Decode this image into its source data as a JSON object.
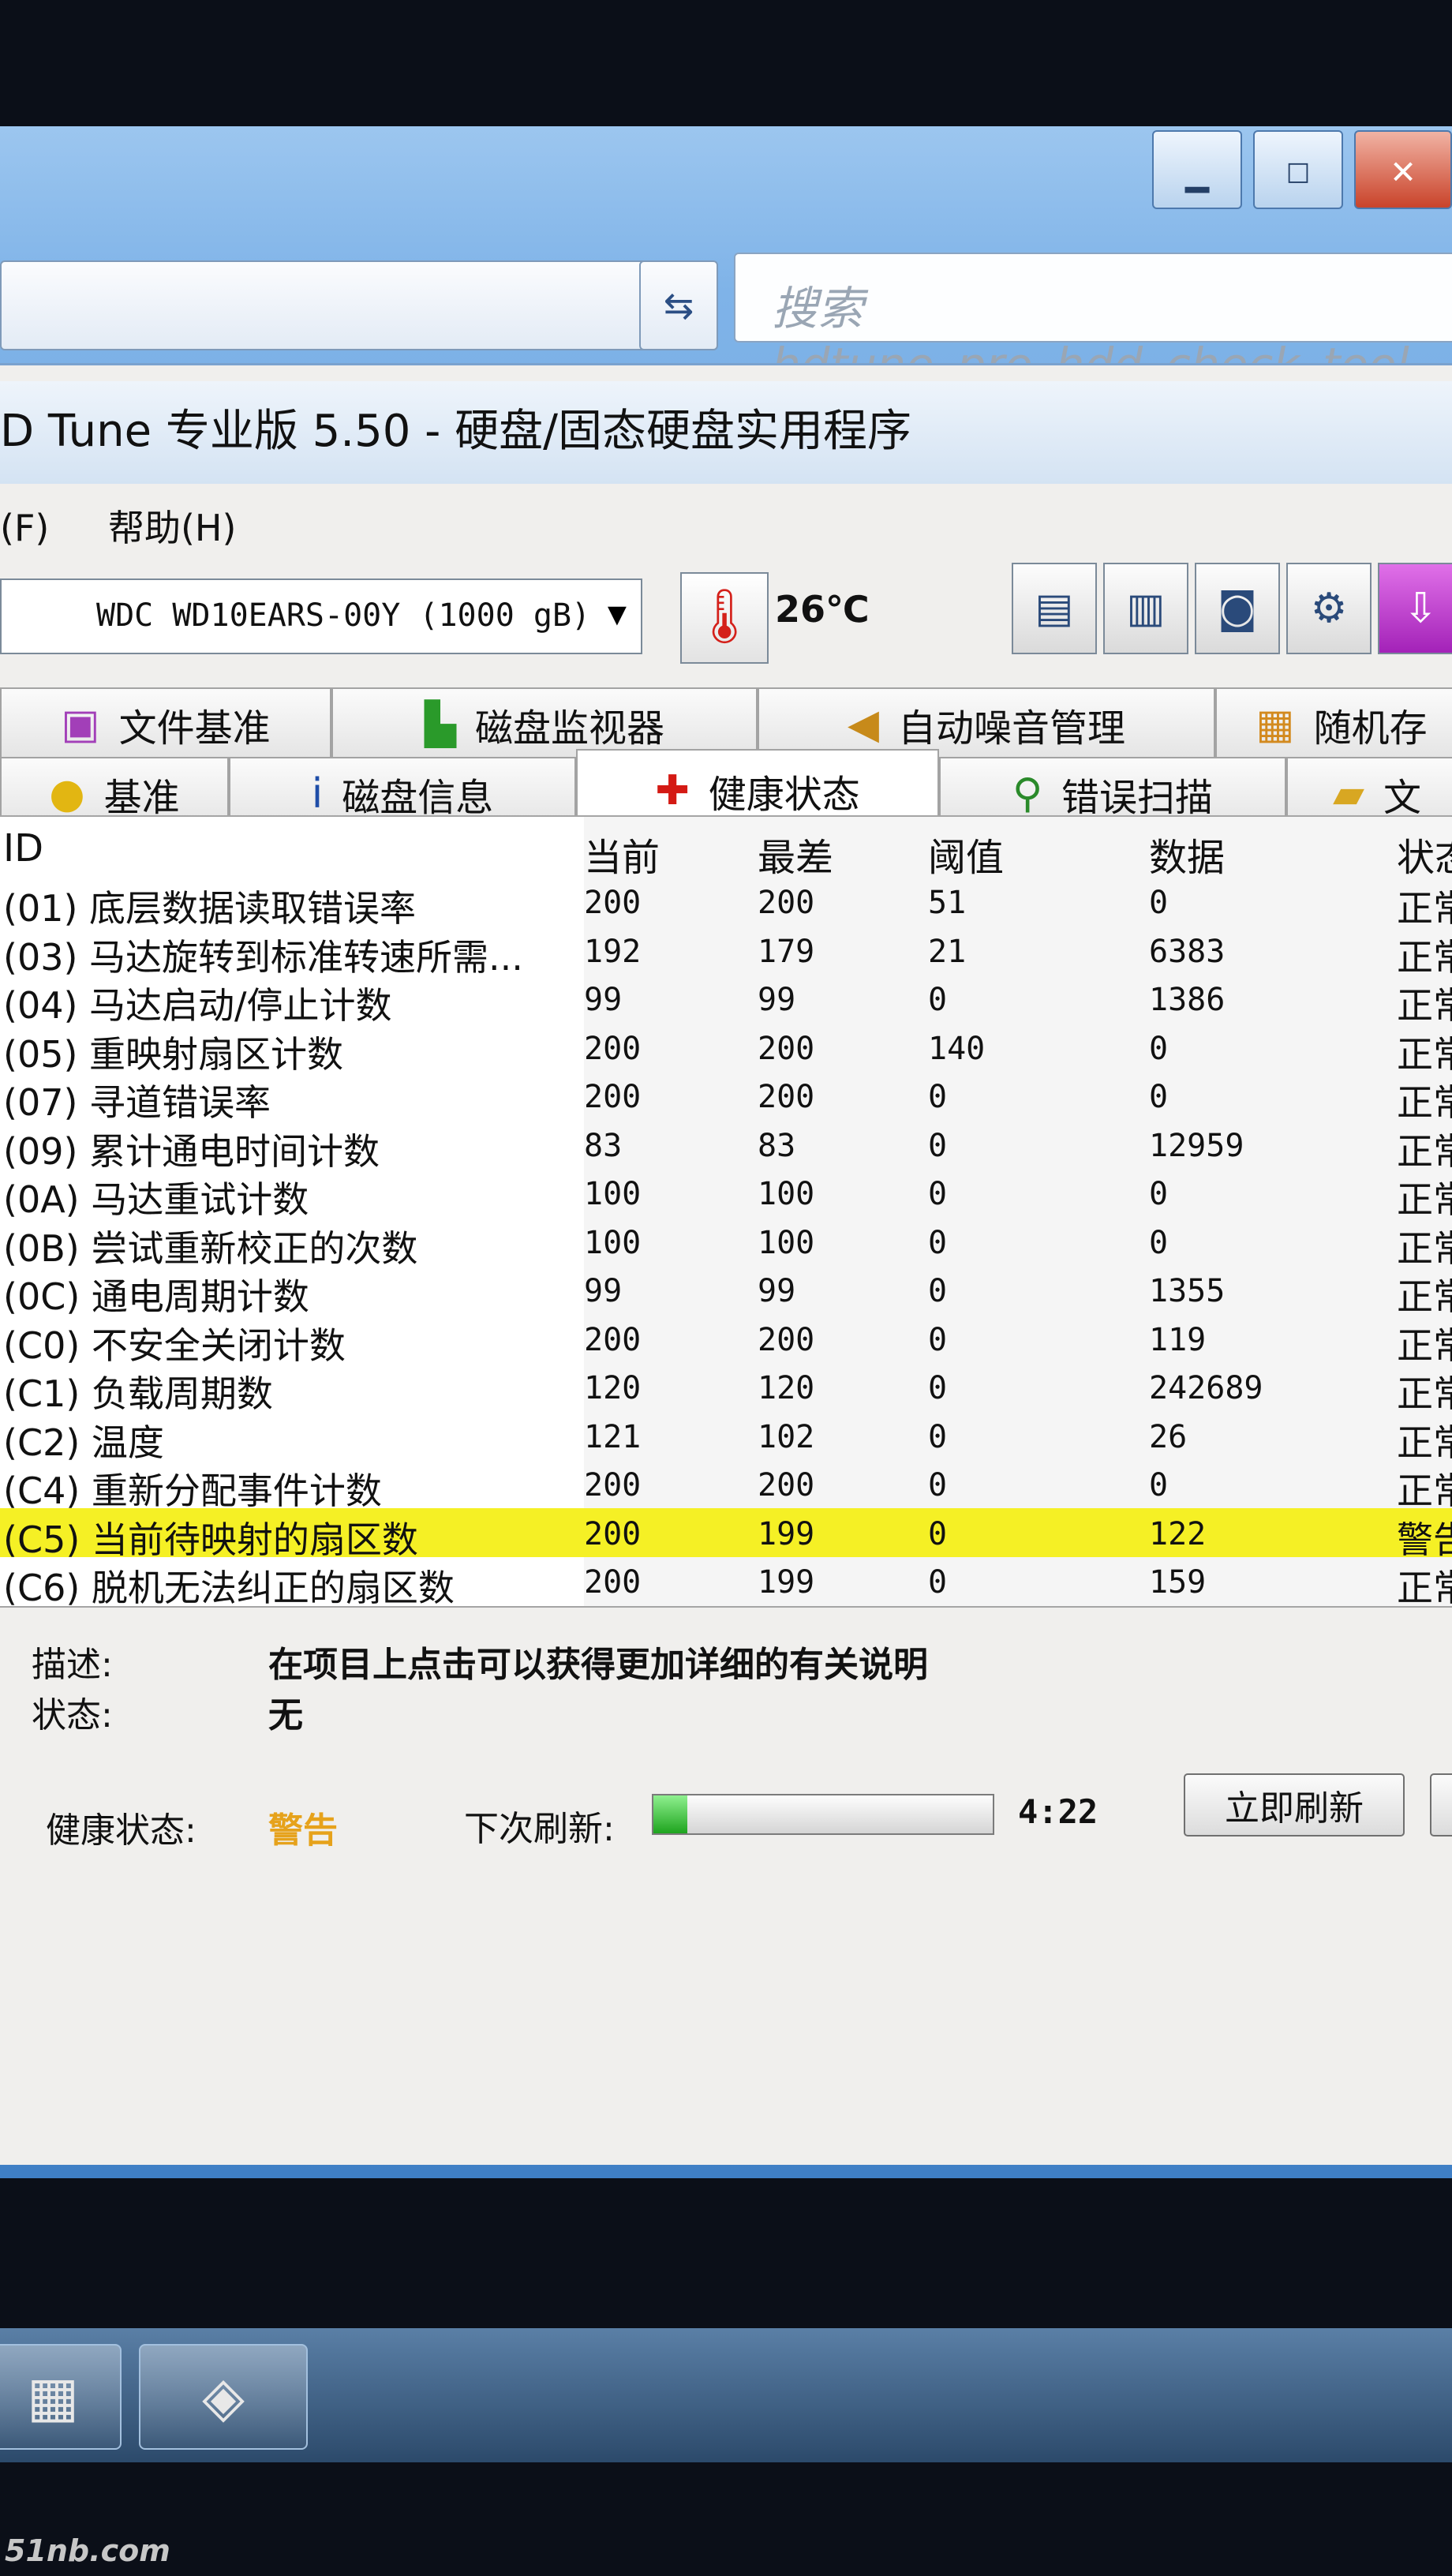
{
  "explorer": {
    "search_placeholder": "搜索 hdtune_pro_hdd_check_tool_...",
    "caption_buttons": [
      "▁",
      "☐",
      "✕"
    ]
  },
  "window": {
    "title": "D Tune 专业版 5.50 - 硬盘/固态硬盘实用程序"
  },
  "menu": [
    "(F)",
    "帮助(H)"
  ],
  "toolbar": {
    "drive": "WDC WD10EARS-00Y (1000 gB)",
    "temperature": "26℃",
    "icons": [
      "copy-text-icon",
      "copy-screen-icon",
      "camera-icon",
      "options-icon",
      "exit-icon"
    ]
  },
  "tabs_top": [
    {
      "label": "文件基准",
      "icon": "file-benchmark-icon"
    },
    {
      "label": "磁盘监视器",
      "icon": "disk-monitor-icon"
    },
    {
      "label": "自动噪音管理",
      "icon": "speaker-icon"
    },
    {
      "label": "随机存",
      "icon": "random-access-icon"
    }
  ],
  "tabs_bottom": [
    {
      "label": "基准",
      "icon": "benchmark-icon"
    },
    {
      "label": "磁盘信息",
      "icon": "info-icon"
    },
    {
      "label": "健康状态",
      "icon": "health-cross-icon"
    },
    {
      "label": "错误扫描",
      "icon": "magnifier-icon"
    },
    {
      "label": "文",
      "icon": "folder-icon"
    }
  ],
  "table": {
    "headers": [
      "ID",
      "当前",
      "最差",
      "阈值",
      "数据",
      "状态"
    ],
    "rows": [
      {
        "name": "(01) 底层数据读取错误率",
        "cur": "200",
        "worst": "200",
        "thr": "51",
        "raw": "0",
        "status": "正常"
      },
      {
        "name": "(03) 马达旋转到标准转速所需...",
        "cur": "192",
        "worst": "179",
        "thr": "21",
        "raw": "6383",
        "status": "正常"
      },
      {
        "name": "(04) 马达启动/停止计数",
        "cur": "99",
        "worst": "99",
        "thr": "0",
        "raw": "1386",
        "status": "正常"
      },
      {
        "name": "(05) 重映射扇区计数",
        "cur": "200",
        "worst": "200",
        "thr": "140",
        "raw": "0",
        "status": "正常"
      },
      {
        "name": "(07) 寻道错误率",
        "cur": "200",
        "worst": "200",
        "thr": "0",
        "raw": "0",
        "status": "正常"
      },
      {
        "name": "(09) 累计通电时间计数",
        "cur": "83",
        "worst": "83",
        "thr": "0",
        "raw": "12959",
        "status": "正常"
      },
      {
        "name": "(0A) 马达重试计数",
        "cur": "100",
        "worst": "100",
        "thr": "0",
        "raw": "0",
        "status": "正常"
      },
      {
        "name": "(0B) 尝试重新校正的次数",
        "cur": "100",
        "worst": "100",
        "thr": "0",
        "raw": "0",
        "status": "正常"
      },
      {
        "name": "(0C) 通电周期计数",
        "cur": "99",
        "worst": "99",
        "thr": "0",
        "raw": "1355",
        "status": "正常"
      },
      {
        "name": "(C0) 不安全关闭计数",
        "cur": "200",
        "worst": "200",
        "thr": "0",
        "raw": "119",
        "status": "正常"
      },
      {
        "name": "(C1) 负载周期数",
        "cur": "120",
        "worst": "120",
        "thr": "0",
        "raw": "242689",
        "status": "正常"
      },
      {
        "name": "(C2) 温度",
        "cur": "121",
        "worst": "102",
        "thr": "0",
        "raw": "26",
        "status": "正常"
      },
      {
        "name": "(C4) 重新分配事件计数",
        "cur": "200",
        "worst": "200",
        "thr": "0",
        "raw": "0",
        "status": "正常"
      },
      {
        "name": "(C5) 当前待映射的扇区数",
        "cur": "200",
        "worst": "199",
        "thr": "0",
        "raw": "122",
        "status": "警告",
        "highlight": true
      },
      {
        "name": "(C6) 脱机无法纠正的扇区数",
        "cur": "200",
        "worst": "199",
        "thr": "0",
        "raw": "159",
        "status": "正常"
      }
    ]
  },
  "description": {
    "desc_label": "描述:",
    "desc_value": "在项目上点击可以获得更加详细的有关说明",
    "state_label": "状态:",
    "state_value": "无"
  },
  "footer": {
    "health_label": "健康状态:",
    "health_value": "警告",
    "health_color": "#e6a21b",
    "next_refresh_label": "下次刷新:",
    "refresh_progress": 0.1,
    "countdown": "4:22",
    "refresh_button": "立即刷新"
  },
  "highlight_color": "#f5f025",
  "watermark": "51nb.com"
}
